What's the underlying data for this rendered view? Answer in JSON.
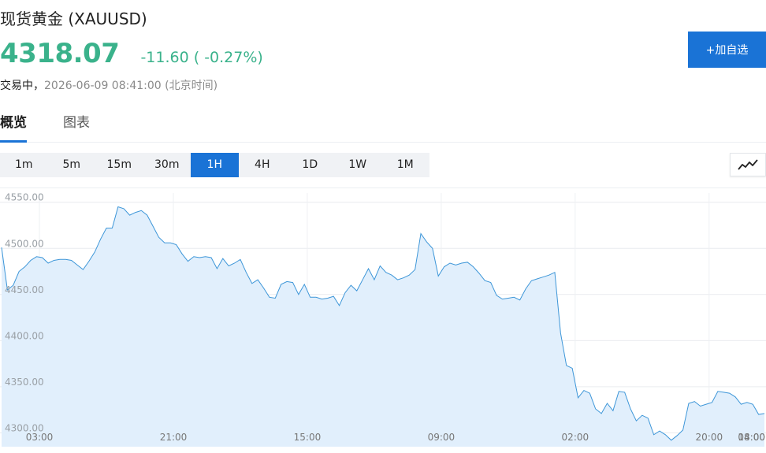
{
  "header": {
    "title": "现货黄金  (XAUUSD)",
    "price": "4318.07",
    "change": "-11.60 ( -0.27%)",
    "status": "交易中，",
    "timestamp": "2026-06-09 08:41:00  (北京时间)",
    "add_watchlist_label": "+加自选",
    "accent_color": "#3ab28b",
    "brand_color": "#1a73d6"
  },
  "tabs": [
    {
      "label": "概览",
      "active": true
    },
    {
      "label": "图表",
      "active": false
    }
  ],
  "periods": [
    {
      "label": "1m",
      "active": false
    },
    {
      "label": "5m",
      "active": false
    },
    {
      "label": "15m",
      "active": false
    },
    {
      "label": "30m",
      "active": false
    },
    {
      "label": "1H",
      "active": true
    },
    {
      "label": "4H",
      "active": false
    },
    {
      "label": "1D",
      "active": false
    },
    {
      "label": "1W",
      "active": false
    },
    {
      "label": "1M",
      "active": false
    }
  ],
  "chart_type_icon": "line-chart-icon",
  "chart_data": {
    "type": "area",
    "title": "",
    "xlabel": "",
    "ylabel": "",
    "ylim": [
      4285,
      4560
    ],
    "yticks": [
      "4550.00",
      "4500.00",
      "4450.00",
      "4400.00",
      "4350.00",
      "4300.00"
    ],
    "ytick_values": [
      4550,
      4500,
      4450,
      4400,
      4350,
      4300
    ],
    "xtick_labels": [
      "03:00",
      "21:00",
      "15:00",
      "09:00",
      "02:00",
      "20:00",
      "14:00",
      "08:00"
    ],
    "xtick_index": [
      6.5,
      29.5,
      52.5,
      75.5,
      98.5,
      121.5,
      144.5,
      167.5
    ],
    "grid": true,
    "line_color": "#3d96d8",
    "fill_color": "#e1effc",
    "series": [
      {
        "values": [
          4501,
          4455,
          4460,
          4475,
          4480,
          4487,
          4491,
          4490,
          4484,
          4487,
          4488,
          4488,
          4487,
          4482,
          4477,
          4486,
          4496,
          4510,
          4522,
          4522,
          4545,
          4543,
          4536,
          4539,
          4541,
          4536,
          4524,
          4512,
          4506,
          4506,
          4504,
          4494,
          4486,
          4491,
          4490,
          4491,
          4490,
          4478,
          4489,
          4481,
          4484,
          4488,
          4474,
          4462,
          4466,
          4457,
          4447,
          4446,
          4461,
          4464,
          4463,
          4450,
          4461,
          4447,
          4447,
          4445,
          4446,
          4448,
          4438,
          4452,
          4460,
          4454,
          4466,
          4478,
          4466,
          4481,
          4474,
          4471,
          4466,
          4468,
          4471,
          4477,
          4516,
          4507,
          4500,
          4470,
          4480,
          4484,
          4482,
          4484,
          4485,
          4480,
          4473,
          4465,
          4463,
          4449,
          4445,
          4446,
          4447,
          4444,
          4456,
          4465,
          4467,
          4469,
          4471,
          4474,
          4408,
          4373,
          4370,
          4338,
          4346,
          4343,
          4326,
          4321,
          4332,
          4324,
          4345,
          4344,
          4326,
          4313,
          4319,
          4316,
          4298,
          4302,
          4298,
          4292,
          4297,
          4303,
          4332,
          4334,
          4329,
          4331,
          4333,
          4345,
          4344,
          4343,
          4339,
          4331,
          4333,
          4331,
          4320,
          4321
        ]
      }
    ]
  }
}
